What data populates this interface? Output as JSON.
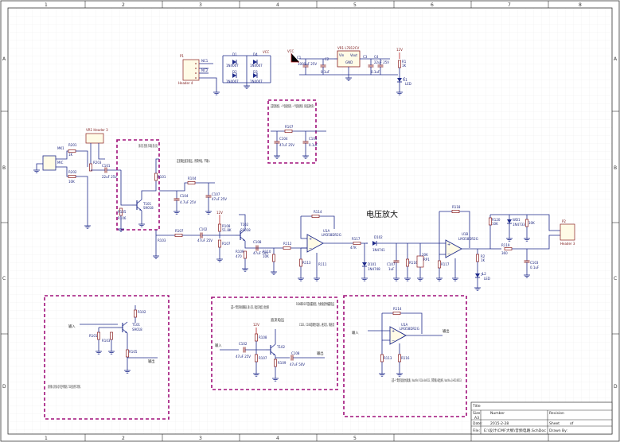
{
  "border": {
    "top_zones": [
      "1",
      "2",
      "3",
      "4",
      "5",
      "6",
      "7",
      "8"
    ],
    "side_zones": [
      "A",
      "B",
      "C",
      "D"
    ]
  },
  "title_block": {
    "title_label": "Title",
    "size_label": "Size",
    "size_value": "A3",
    "number_label": "Number",
    "revision_label": "Revision",
    "date_label": "Date:",
    "date_value": "2015-2-28",
    "sheet_label": "Sheet",
    "sheet_value": "of",
    "file_label": "File:",
    "file_value": "E:\\设计\\CMF大纲\\音频电路.SchDoc",
    "drawn_label": "Drawn By:"
  },
  "section_title": "电压放大",
  "annotations": {
    "power_filter": "这是电源滤波，一个电容滤低频，一个电容滤高频，发电压波纹减小",
    "input_stage": "音频输入的交流信号，整流后经电阻，接T102的集电极，使得放大。直流电压",
    "input_stage_side": "这里输出直流电压，用来供电，不输入",
    "box1": "此时的输入信号为输入信号的正半周期波形，T101在此处用于工作饱和。",
    "box1_in": "输入",
    "box1_out": "输出",
    "box2": "这是一个典型的射极跟随器，输入信号，输出信号幅度，相位相同",
    "box2_side": "R108和R107是偏置电阻，为射极提供偏置电压",
    "box2_caps": "C102、C106是耦合电容，通交流，隔直流",
    "box2_dc": "直流电压",
    "box2_in": "输入",
    "box2_out": "输出",
    "box3": "这是一个典型的运放放大器电路，（Vout/Vin）R114=Vin/R113，可得到输入输出关系，Vout/Vin=(1+R114/R113)",
    "box3_in": "输入",
    "box3_out": "输出"
  },
  "components": {
    "P1": "P1",
    "P1_name": "Header 4",
    "NC1": "NC1",
    "NC2": "NC2",
    "D1": "D1",
    "D2": "D2",
    "D3": "D3",
    "D4": "D4",
    "D_part": "1N4007",
    "VCC": "VCC",
    "C1": "C1",
    "C1_val": "1000uF 25V",
    "C2": "C2",
    "C2_val": "0.1uF",
    "VR1": "VR1 L7812CV",
    "Vin": "Vin",
    "Vout": "Vout",
    "GND": "GND",
    "C3": "C3",
    "C3_val": "22uF 25V",
    "C4": "C4",
    "C4_val": "0.1uF",
    "R1": "R1",
    "R1_val": "1K",
    "L1": "L1",
    "LED": "LED",
    "R107": "R107",
    "C104": "C104",
    "C104_val": "47uF 25V",
    "C105": "C105",
    "C105_val": "0.1uF",
    "MK1": "MK1",
    "MIC": "MIC",
    "VR1h": "VR1 Header 3",
    "R201": "R201",
    "R202": "R202",
    "R203": "R203",
    "R_1k": "1K",
    "R_10k": "10K",
    "C101": "C101",
    "C101_val": "22uF 25V",
    "R101": "R101",
    "C104b": "C104",
    "C104b_val": "4.7uF 25V",
    "R105": "R105",
    "R106": "R106",
    "T101": "T101",
    "S9018": "S9018",
    "R104": "R104",
    "C107": "C107",
    "C107_val": "47uF 25V",
    "C102": "C102",
    "C102_val": "47uF 25V",
    "R108": "R108",
    "R108_val": "51.8K",
    "T102": "T102",
    "S9018b": "S9018",
    "R109": "R109",
    "R109_val": "470",
    "C108": "C108",
    "C108_val": "47uF 50V",
    "R110": "R110",
    "R110_val": "10K",
    "R111": "R111",
    "U1A": "U1A",
    "LM358": "LM358DR2G",
    "R113": "R113",
    "R114": "R114",
    "R112": "R112",
    "D102": "D102",
    "D102_val": "1N4741",
    "D101": "D101",
    "D101_val": "1N4748",
    "R117": "R117",
    "R117_val": "47K",
    "C107b": "C107",
    "C107b_val": "1uF",
    "R116": "R116",
    "R115": "R115",
    "RP1": "RP1",
    "RP1_val": "20K",
    "U1B": "U1B",
    "R118": "R118",
    "R120": "R120",
    "WD1": "WD1",
    "WD1_val": "1N4733",
    "R119": "R119",
    "R119_val": "360",
    "C103": "C103",
    "C103_val": "0.1uF",
    "P2": "P2",
    "P2_name": "Header 3",
    "R2": "R2",
    "R2_val": "1K",
    "L2": "L2",
    "LED2": "LED",
    "b1_R102": "R102",
    "b1_R101": "R101",
    "b1_R103": "R103",
    "b1_R105": "R105",
    "b1_T101": "T101",
    "b1_S9018": "S9018",
    "b2_C102": "C102",
    "b2_C102_val": "47uF 25V",
    "b2_R108": "R108",
    "b2_R107": "R107",
    "b2_T102": "T102",
    "b2_R109": "R109",
    "b2_C108": "C108",
    "b2_C108_val": "47uF 50V",
    "b2_12V": "12V",
    "b3_U1A": "U1A",
    "b3_LM358": "LM358DR2G",
    "b3_R114": "R114",
    "b3_R113": "R113",
    "b3_R116": "R116"
  }
}
